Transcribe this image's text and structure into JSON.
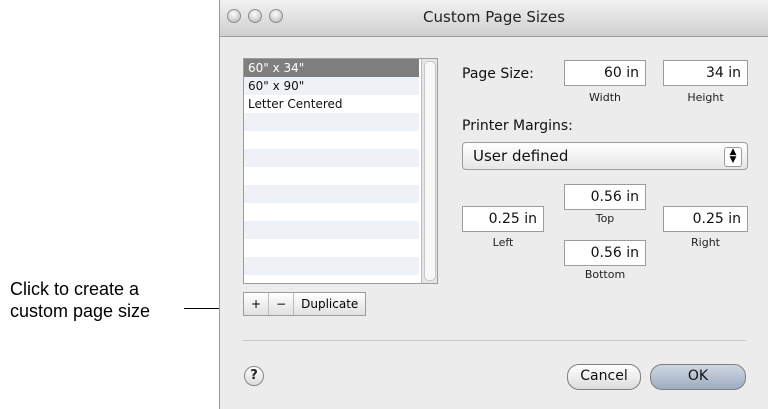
{
  "callout": {
    "line1": "Click to create a",
    "line2": "custom page size"
  },
  "window": {
    "title": "Custom Page Sizes"
  },
  "list": {
    "items": [
      "60\" x 34\"",
      "60\" x 90\"",
      "Letter Centered"
    ],
    "selected_index": 0
  },
  "list_buttons": {
    "add": "+",
    "remove": "−",
    "duplicate": "Duplicate"
  },
  "page_size": {
    "label": "Page Size:",
    "width_value": "60 in",
    "height_value": "34 in",
    "width_label": "Width",
    "height_label": "Height"
  },
  "margins": {
    "label": "Printer Margins:",
    "preset": "User defined",
    "top": "0.56 in",
    "left": "0.25 in",
    "right": "0.25 in",
    "bottom": "0.56 in",
    "top_label": "Top",
    "left_label": "Left",
    "right_label": "Right",
    "bottom_label": "Bottom"
  },
  "footer": {
    "help": "?",
    "cancel": "Cancel",
    "ok": "OK"
  }
}
